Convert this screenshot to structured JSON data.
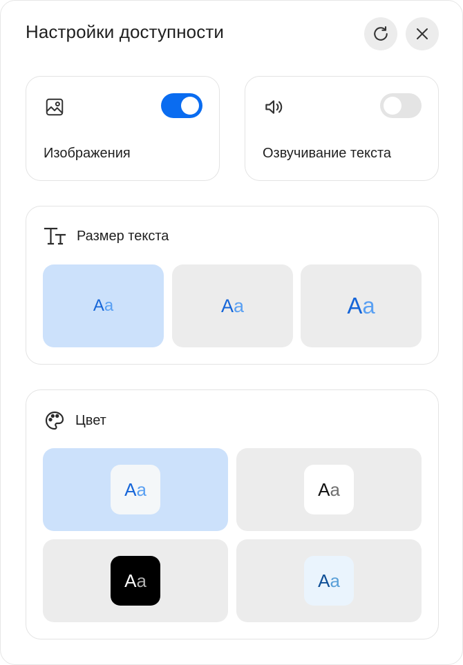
{
  "dialog": {
    "title": "Настройки доступности",
    "icons": {
      "refresh": "refresh-icon",
      "close": "close-icon"
    }
  },
  "toggles": [
    {
      "label": "Изображения",
      "icon": "image-icon",
      "enabled": true
    },
    {
      "label": "Озвучивание текста",
      "icon": "speaker-icon",
      "enabled": false
    }
  ],
  "text_size": {
    "label": "Размер текста",
    "icon": "text-size-icon",
    "options": [
      {
        "big": "A",
        "small": "a",
        "selected": true
      },
      {
        "big": "A",
        "small": "a",
        "selected": false
      },
      {
        "big": "A",
        "small": "a",
        "selected": false
      }
    ]
  },
  "color": {
    "label": "Цвет",
    "icon": "palette-icon",
    "options": [
      {
        "big": "A",
        "small": "a",
        "selected": true,
        "swatch_bg": "#f4f7f9",
        "big_color": "#1565d8",
        "small_color": "#5aa0f2"
      },
      {
        "big": "A",
        "small": "a",
        "selected": false,
        "swatch_bg": "#ffffff",
        "big_color": "#111111",
        "small_color": "#707070"
      },
      {
        "big": "A",
        "small": "a",
        "selected": false,
        "swatch_bg": "#000000",
        "big_color": "#ffffff",
        "small_color": "#b0b0b0"
      },
      {
        "big": "A",
        "small": "a",
        "selected": false,
        "swatch_bg": "#eaf4fd",
        "big_color": "#0f4f96",
        "small_color": "#5aa0d8"
      }
    ]
  },
  "colors": {
    "accent": "#0a6cf0",
    "selected_bg": "#cce1fb",
    "option_bg": "#ececec"
  }
}
